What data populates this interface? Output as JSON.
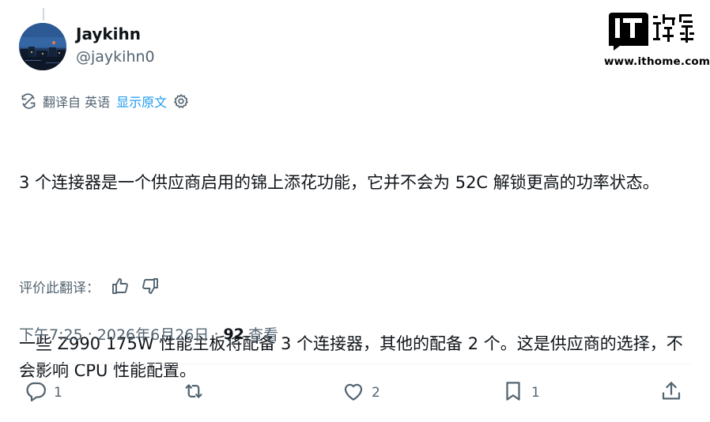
{
  "author": {
    "name": "Jaykihn",
    "handle": "@jaykihn0"
  },
  "brand": {
    "logo_text": "IT之家",
    "url": "www.ithome.com"
  },
  "translation": {
    "translated_from": "翻译自 英语",
    "show_original": "显示原文"
  },
  "tweet": {
    "paragraph1": "3 个连接器是一个供应商启用的锦上添花功能，它并不会为 52C 解锁更高的功率状态。",
    "paragraph2": "一些 Z990 175W 性能主板将配备 3 个连接器，其他的配备 2 个。这是供应商的选择，不会影响 CPU 性能配置。"
  },
  "rating": {
    "label": "评价此翻译："
  },
  "meta": {
    "time": "下午7:25",
    "sep1": " · ",
    "date": "2026年6月26日",
    "sep2": " · ",
    "views": "92",
    "views_label": "查看"
  },
  "actions": {
    "reply_count": "1",
    "retweet_count": "",
    "like_count": "2",
    "bookmark_count": "1"
  },
  "colors": {
    "accent": "#1d9bf0",
    "secondary_text": "#536471",
    "primary_text": "#0f1419"
  },
  "icons": [
    "translate-icon",
    "gear-icon",
    "thumbs-up-icon",
    "thumbs-down-icon",
    "reply-icon",
    "retweet-icon",
    "like-icon",
    "bookmark-icon",
    "share-icon"
  ]
}
